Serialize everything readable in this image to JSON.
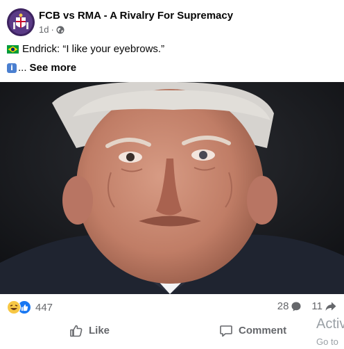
{
  "post": {
    "page_name": "FCB vs RMA - A Rivalry For Supremacy",
    "time": "1d",
    "separator": "·",
    "text_line1": "Endrick: “I like your eyebrows.”",
    "text_line2_prefix": "...",
    "see_more_label": "See more"
  },
  "icons": {
    "avatar": "club-crest-icon",
    "privacy": "globe-icon",
    "flag": "brazil-flag-icon",
    "info": "info-icon",
    "photo": "post-photo"
  },
  "stats": {
    "reactions_count": "447",
    "comments_count": "28",
    "shares_count": "11"
  },
  "actions": {
    "like_label": "Like",
    "comment_label": "Comment"
  },
  "watermark": {
    "line1": "Activ",
    "line2": "Go to"
  },
  "colors": {
    "text": "#050505",
    "secondary": "#65676b",
    "like_blue": "#1877f2",
    "haha_yellow": "#f7c744"
  }
}
